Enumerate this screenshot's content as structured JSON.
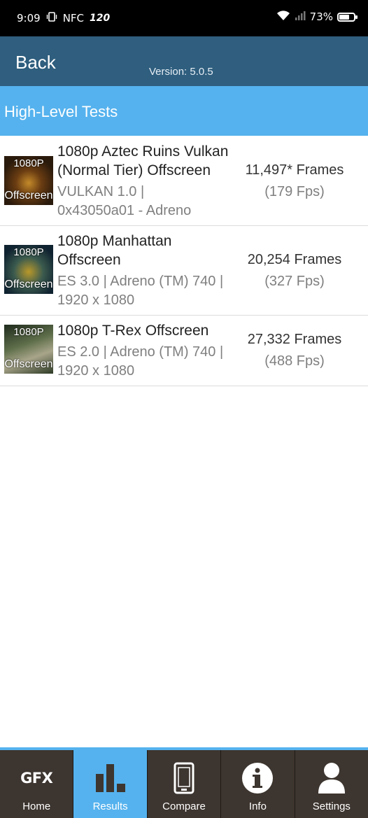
{
  "status_bar": {
    "time": "9:09",
    "nfc": "NFC",
    "refresh_rate": "120",
    "battery": "73%",
    "battery_level": 0.73
  },
  "header": {
    "back_label": "Back",
    "version": "Version: 5.0.5"
  },
  "section": {
    "title": "High-Level Tests"
  },
  "tests": [
    {
      "thumb_top": "1080P",
      "thumb_bottom": "Offscreen",
      "name_line1": "1080p Aztec Ruins Vulkan",
      "name_line2": "(Normal Tier) Offscreen",
      "desc_line1": "VULKAN 1.0 |",
      "desc_line2": "0x43050a01 - Adreno",
      "score": "11,497* Frames",
      "fps": "(179 Fps)"
    },
    {
      "thumb_top": "1080P",
      "thumb_bottom": "Offscreen",
      "name_line1": "1080p Manhattan",
      "name_line2": "Offscreen",
      "desc_line1": "ES 3.0 | Adreno (TM) 740 |",
      "desc_line2": "1920 x 1080",
      "score": "20,254 Frames",
      "fps": "(327 Fps)"
    },
    {
      "thumb_top": "1080P",
      "thumb_bottom": "Offscreen",
      "name_line1": "1080p T-Rex Offscreen",
      "desc_line1": "ES 2.0 | Adreno (TM) 740 |",
      "desc_line2": "1920 x 1080",
      "score": "27,332 Frames",
      "fps": "(488 Fps)"
    }
  ],
  "nav": {
    "gfx_logo": "GFX",
    "home": "Home",
    "results": "Results",
    "compare": "Compare",
    "info": "Info",
    "settings": "Settings"
  },
  "colors": {
    "header_bg": "#2f5e7e",
    "accent": "#55b2ee",
    "nav_bg": "#3d352f"
  }
}
